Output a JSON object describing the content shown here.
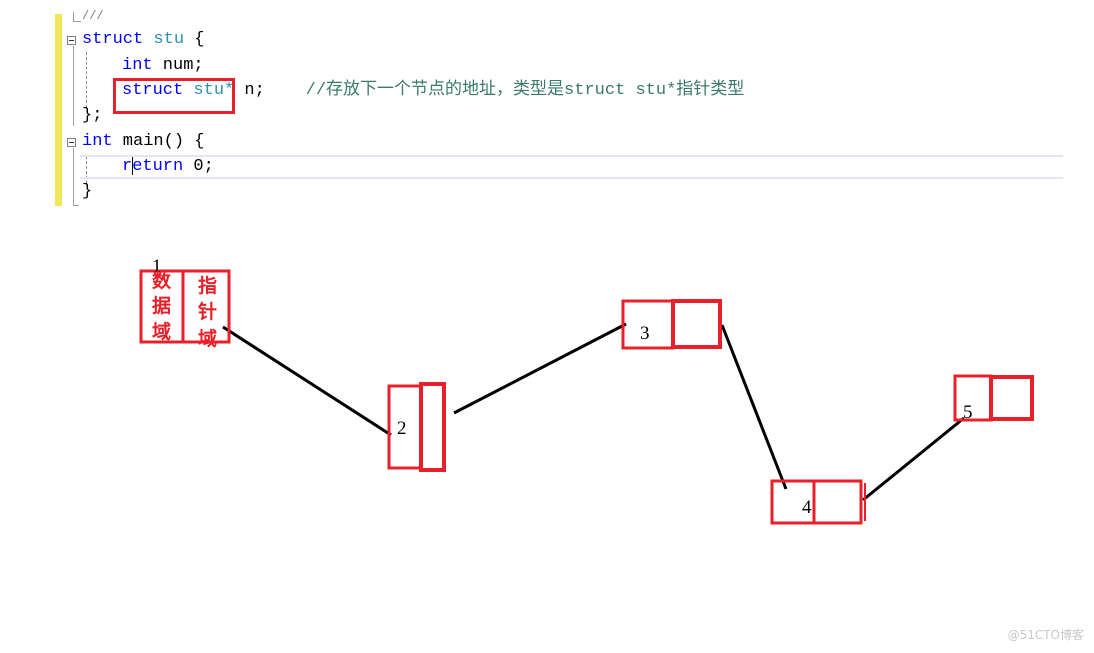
{
  "editor": {
    "lines": [
      {
        "id": "comment-end",
        "text": "///"
      },
      {
        "id": "struct-decl",
        "keyword": "struct",
        "type": "stu",
        "rest": " {"
      },
      {
        "id": "field-num",
        "keyword": "int",
        "rest": " num;"
      },
      {
        "id": "field-next",
        "keyword": "struct",
        "type": "stu*",
        "rest": " n;",
        "comment": "//存放下一个节点的地址，类型是struct stu*指针类型"
      },
      {
        "id": "struct-close",
        "text": "};"
      },
      {
        "id": "main-decl",
        "keyword": "int",
        "rest": " main() {"
      },
      {
        "id": "return-stmt",
        "keyword": "return",
        "rest": " 0;"
      },
      {
        "id": "main-close",
        "text": "}"
      }
    ]
  },
  "diagram": {
    "colors": {
      "box": "#e8202a",
      "link": "#000000"
    },
    "node1": {
      "label": "1",
      "data_field": [
        "数",
        "据",
        "域"
      ],
      "pointer_field": [
        "指",
        "针",
        "域"
      ]
    },
    "nodes": [
      {
        "label": "1"
      },
      {
        "label": "2"
      },
      {
        "label": "3"
      },
      {
        "label": "4"
      },
      {
        "label": "5"
      }
    ]
  },
  "watermark": "@51CTO博客"
}
